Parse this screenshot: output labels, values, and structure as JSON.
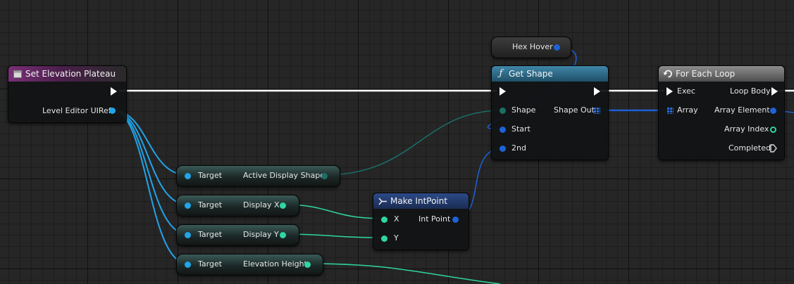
{
  "nodes": {
    "set_elevation": {
      "title": "Set Elevation Plateau",
      "pin_ref": "Level Editor UIRef"
    },
    "active_display_shape": {
      "target": "Target",
      "output": "Active Display Shape"
    },
    "display_x": {
      "target": "Target",
      "output": "Display X"
    },
    "display_y": {
      "target": "Target",
      "output": "Display Y"
    },
    "elevation_height": {
      "target": "Target",
      "output": "Elevation Height"
    },
    "make_intpoint": {
      "title": "Make IntPoint",
      "in_x": "X",
      "in_y": "Y",
      "out": "Int Point"
    },
    "hex_hover": {
      "label": "Hex Hover"
    },
    "get_shape": {
      "title": "Get Shape",
      "in_shape": "Shape",
      "in_start": "Start",
      "in_2nd": "2nd",
      "out_shape": "Shape Out"
    },
    "for_each_loop": {
      "title": "For Each Loop",
      "exec": "Exec",
      "array": "Array",
      "loop_body": "Loop Body",
      "array_element": "Array Element",
      "array_index": "Array Index",
      "completed": "Completed"
    }
  },
  "colors": {
    "object_pin": "#21a4e8",
    "struct_pin": "#1e62d6",
    "int_pin": "#2fd6a2",
    "shape_pin": "#1b6f66",
    "exec_wire": "#ffffff"
  },
  "icons": {
    "function": "function-icon",
    "event": "event-icon",
    "loop": "loop-icon",
    "make": "make-struct-icon"
  }
}
